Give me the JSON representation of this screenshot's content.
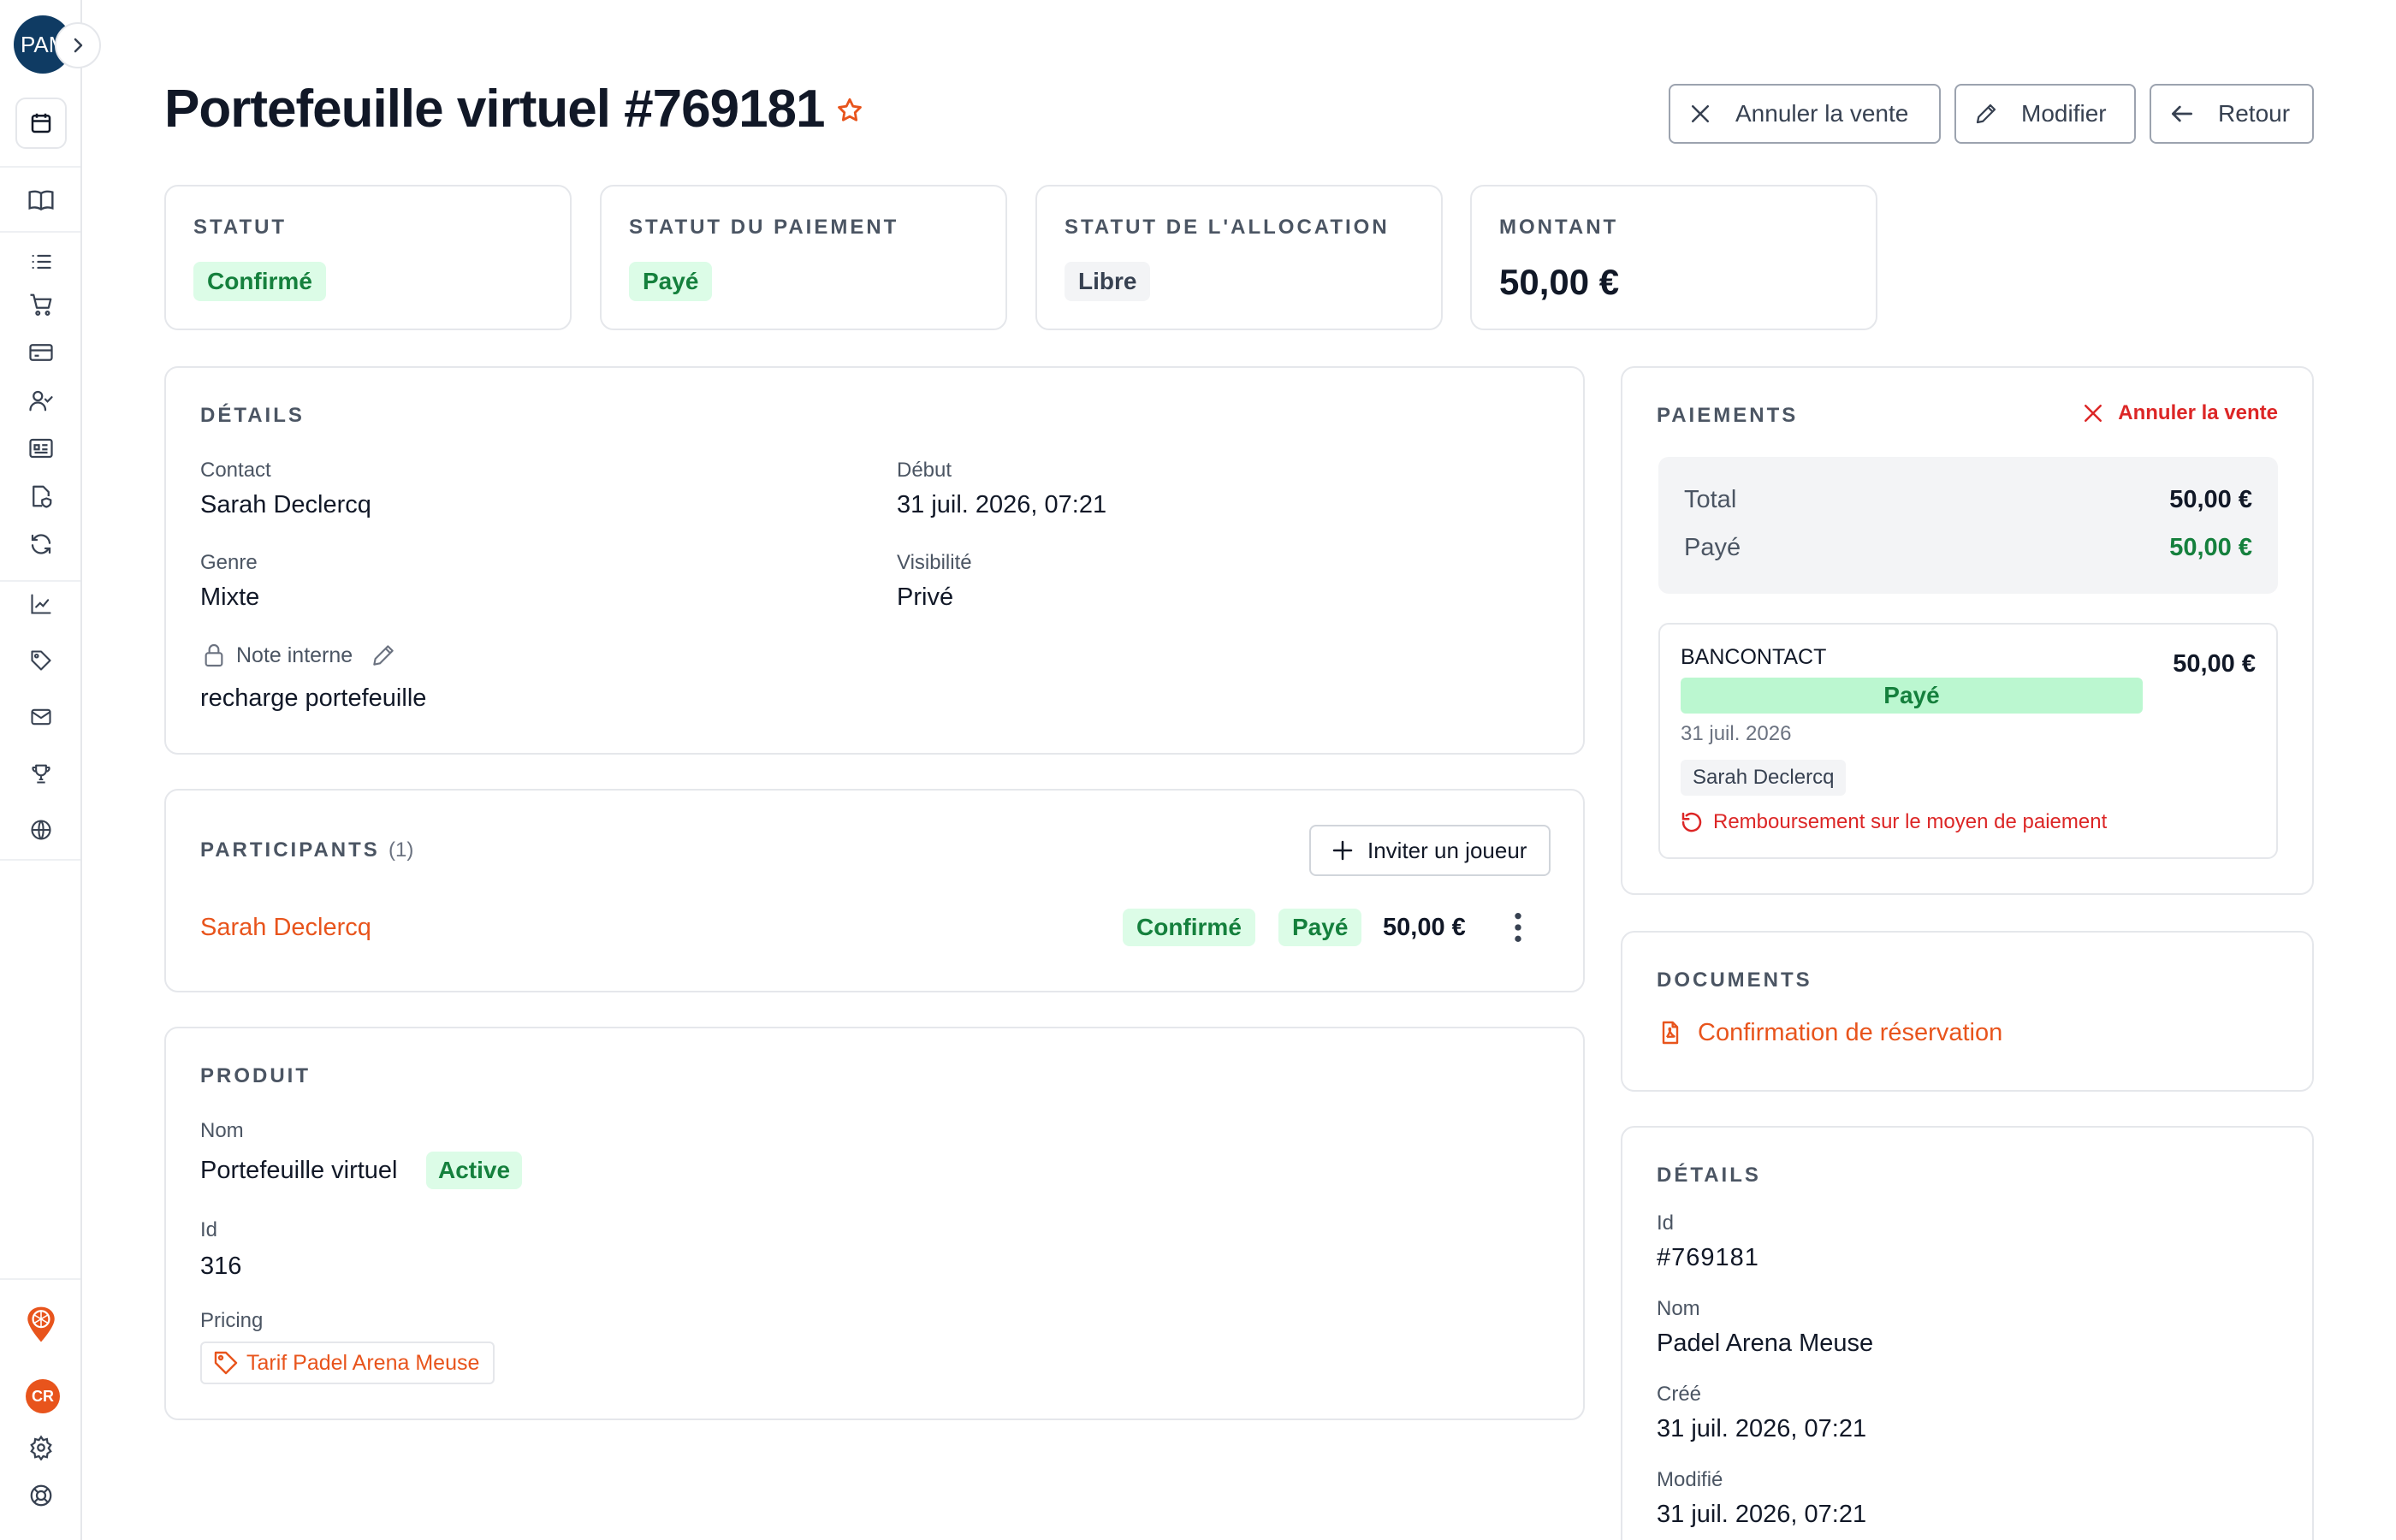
{
  "sidebar": {
    "avatar_initials": "PAM",
    "footer_avatar": "CR",
    "icons": [
      "calendar-icon",
      "book-icon",
      "list-icon",
      "cart-icon",
      "credit-card-icon",
      "user-check-icon",
      "id-card-icon",
      "file-shield-icon",
      "refresh-icon",
      "chart-icon",
      "tag-icon",
      "mail-icon",
      "trophy-icon",
      "globe-icon",
      "padel-logo-icon",
      "settings-icon",
      "help-icon"
    ]
  },
  "header": {
    "title": "Portefeuille virtuel #769181",
    "cancel_label": "Annuler la vente",
    "edit_label": "Modifier",
    "back_label": "Retour"
  },
  "status_cards": [
    {
      "label": "STATUT",
      "value": "Confirmé"
    },
    {
      "label": "STATUT DU PAIEMENT",
      "value": "Payé"
    },
    {
      "label": "STATUT DE L'ALLOCATION",
      "value": "Libre"
    },
    {
      "label": "MONTANT",
      "value": "50,00 €"
    }
  ],
  "details": {
    "title": "DÉTAILS",
    "contact_label": "Contact",
    "contact_value": "Sarah Declercq",
    "debut_label": "Début",
    "debut_value": "31 juil. 2026, 07:21",
    "genre_label": "Genre",
    "genre_value": "Mixte",
    "visibility_label": "Visibilité",
    "visibility_value": "Privé",
    "note_label": "Note interne",
    "note_value": "recharge portefeuille"
  },
  "participants": {
    "title": "PARTICIPANTS",
    "count": "(1)",
    "invite_label": "Inviter un joueur",
    "rows": [
      {
        "name": "Sarah Declercq",
        "status": "Confirmé",
        "payment": "Payé",
        "amount": "50,00 €"
      }
    ]
  },
  "product": {
    "title": "PRODUIT",
    "name_label": "Nom",
    "name_value": "Portefeuille virtuel",
    "name_badge": "Active",
    "id_label": "Id",
    "id_value": "316",
    "pricing_label": "Pricing",
    "pricing_value": "Tarif Padel Arena Meuse"
  },
  "payments": {
    "title": "PAIEMENTS",
    "cancel_label": "Annuler la vente",
    "total_label": "Total",
    "total_value": "50,00 €",
    "paid_label": "Payé",
    "paid_value": "50,00 €",
    "method": "BANCONTACT",
    "method_amount": "50,00 €",
    "method_status": "Payé",
    "method_date": "31 juil. 2026",
    "method_person": "Sarah Declercq",
    "refund_label": "Remboursement sur le moyen de paiement"
  },
  "documents": {
    "title": "DOCUMENTS",
    "link": "Confirmation de réservation"
  },
  "side_details": {
    "title": "DÉTAILS",
    "id_label": "Id",
    "id_value": "#769181",
    "name_label": "Nom",
    "name_value": "Padel Arena Meuse",
    "created_label": "Créé",
    "created_value": "31 juil. 2026, 07:21",
    "modified_label": "Modifié",
    "modified_value": "31 juil. 2026, 07:21"
  },
  "colors": {
    "accent": "#e8541c",
    "success_bg": "#dcfce7",
    "success_text": "#15803d",
    "danger": "#dc2626",
    "navy": "#0f3b63"
  }
}
